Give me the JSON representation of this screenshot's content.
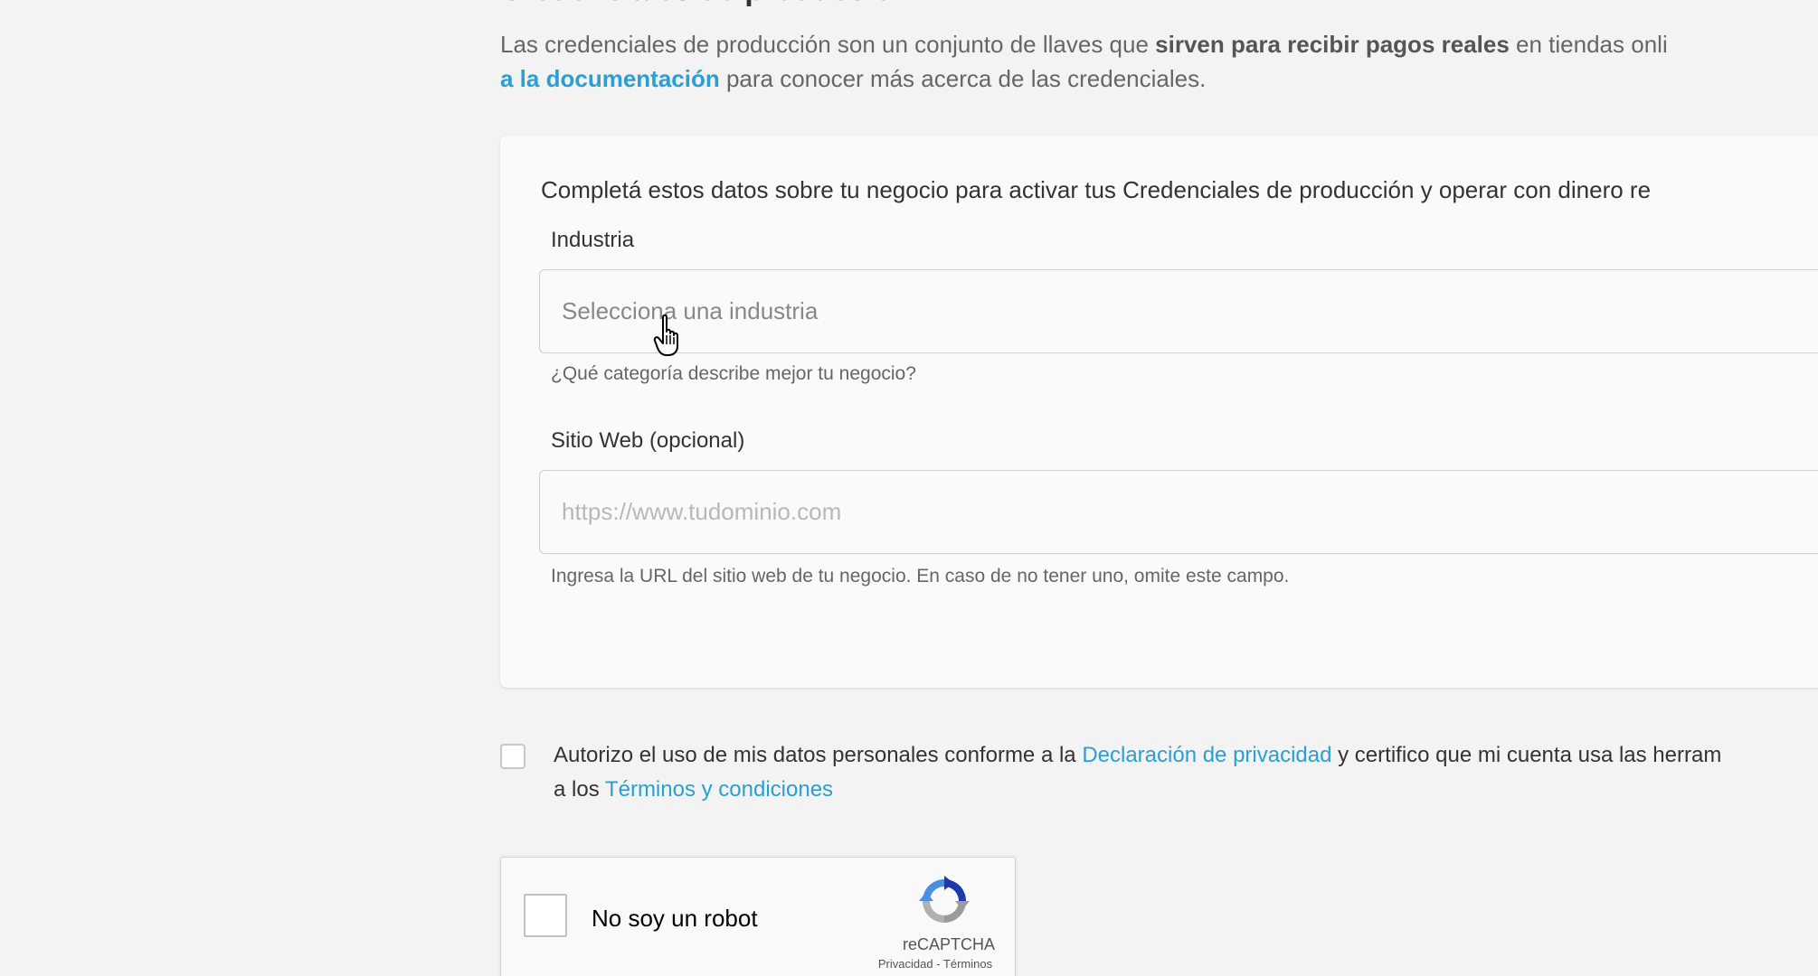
{
  "page": {
    "heading": "Credenciales de producción",
    "intro": {
      "part1": "Las credenciales de producción son un conjunto de llaves que ",
      "bold": "sirven para recibir pagos reales",
      "part2": " en tiendas onli",
      "link": "a la documentación",
      "part3": " para conocer más acerca de las credenciales."
    }
  },
  "form": {
    "intro": "Completá estos datos sobre tu negocio para activar tus Credenciales de producción y operar con dinero re",
    "industry": {
      "label": "Industria",
      "placeholder": "Selecciona una industria",
      "help": "¿Qué categoría describe mejor tu negocio?"
    },
    "website": {
      "label": "Sitio Web (opcional)",
      "placeholder": "https://www.tudominio.com",
      "help": "Ingresa la URL del sitio web de tu negocio. En caso de no tener uno, omite este campo."
    }
  },
  "consent": {
    "part1": "Autorizo el uso de mis datos personales conforme a la ",
    "privacy_link": "Declaración de privacidad",
    "part2": " y certifico que mi cuenta usa las herram",
    "part3": "a los ",
    "terms_link": "Términos y condiciones"
  },
  "recaptcha": {
    "label": "No soy un robot",
    "brand": "reCAPTCHA",
    "privacy": "Privacidad",
    "separator": " - ",
    "terms": "Términos"
  },
  "colors": {
    "link": "#2a9fd6",
    "background": "#f3f3f3",
    "card": "#fafafa"
  }
}
